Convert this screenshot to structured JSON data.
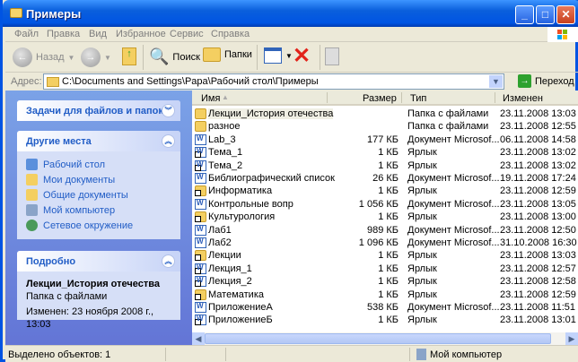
{
  "window": {
    "title": "Примеры"
  },
  "menu": [
    "Файл",
    "Правка",
    "Вид",
    "Избранное",
    "Сервис",
    "Справка"
  ],
  "toolbar": {
    "back": "Назад",
    "search": "Поиск",
    "folders": "Папки"
  },
  "address": {
    "label": "Адрес:",
    "value": "C:\\Documents and Settings\\Papa\\Рабочий стол\\Примеры",
    "go": "Переход"
  },
  "left": {
    "tasks": {
      "title": "Задачи для файлов и папок"
    },
    "places": {
      "title": "Другие места",
      "items": [
        "Рабочий стол",
        "Мои документы",
        "Общие документы",
        "Мой компьютер",
        "Сетевое окружение"
      ]
    },
    "details": {
      "title": "Подробно",
      "name": "Лекции_История отечества",
      "type": "Папка с файлами",
      "modified": "Изменен: 23 ноября 2008 г., 13:03"
    }
  },
  "columns": {
    "name": "Имя",
    "size": "Размер",
    "type": "Тип",
    "modified": "Изменен"
  },
  "files": [
    {
      "name": "Лекции_История отечества",
      "size": "",
      "type": "Папка с файлами",
      "modified": "23.11.2008 13:03",
      "icon": "folder"
    },
    {
      "name": "разное",
      "size": "",
      "type": "Папка с файлами",
      "modified": "23.11.2008 12:55",
      "icon": "folder"
    },
    {
      "name": "Lab_3",
      "size": "177 КБ",
      "type": "Документ Microsof...",
      "modified": "06.11.2008 14:58",
      "icon": "doc"
    },
    {
      "name": "Тема_1",
      "size": "1 КБ",
      "type": "Ярлык",
      "modified": "23.11.2008 13:02",
      "icon": "doc-link"
    },
    {
      "name": "Тема_2",
      "size": "1 КБ",
      "type": "Ярлык",
      "modified": "23.11.2008 13:02",
      "icon": "doc-link"
    },
    {
      "name": "Библиографический список",
      "size": "26 КБ",
      "type": "Документ Microsof...",
      "modified": "19.11.2008 17:24",
      "icon": "doc"
    },
    {
      "name": "Информатика",
      "size": "1 КБ",
      "type": "Ярлык",
      "modified": "23.11.2008 12:59",
      "icon": "folder-link"
    },
    {
      "name": "Контрольные вопр",
      "size": "1 056 КБ",
      "type": "Документ Microsof...",
      "modified": "23.11.2008 13:05",
      "icon": "doc"
    },
    {
      "name": "Культурология",
      "size": "1 КБ",
      "type": "Ярлык",
      "modified": "23.11.2008 13:00",
      "icon": "folder-link"
    },
    {
      "name": "Лаб1",
      "size": "989 КБ",
      "type": "Документ Microsof...",
      "modified": "23.11.2008 12:50",
      "icon": "doc"
    },
    {
      "name": "Лаб2",
      "size": "1 096 КБ",
      "type": "Документ Microsof...",
      "modified": "31.10.2008 16:30",
      "icon": "doc"
    },
    {
      "name": "Лекции",
      "size": "1 КБ",
      "type": "Ярлык",
      "modified": "23.11.2008 13:03",
      "icon": "folder-link"
    },
    {
      "name": "Лекция_1",
      "size": "1 КБ",
      "type": "Ярлык",
      "modified": "23.11.2008 12:57",
      "icon": "doc-link"
    },
    {
      "name": "Лекция_2",
      "size": "1 КБ",
      "type": "Ярлык",
      "modified": "23.11.2008 12:58",
      "icon": "doc-link"
    },
    {
      "name": "Математика",
      "size": "1 КБ",
      "type": "Ярлык",
      "modified": "23.11.2008 12:59",
      "icon": "folder-link"
    },
    {
      "name": "ПриложениеА",
      "size": "538 КБ",
      "type": "Документ Microsof...",
      "modified": "23.11.2008 11:51",
      "icon": "doc"
    },
    {
      "name": "ПриложениеБ",
      "size": "1 КБ",
      "type": "Ярлык",
      "modified": "23.11.2008 13:01",
      "icon": "doc-link"
    }
  ],
  "status": {
    "selected": "Выделено объектов: 1",
    "location": "Мой компьютер"
  }
}
